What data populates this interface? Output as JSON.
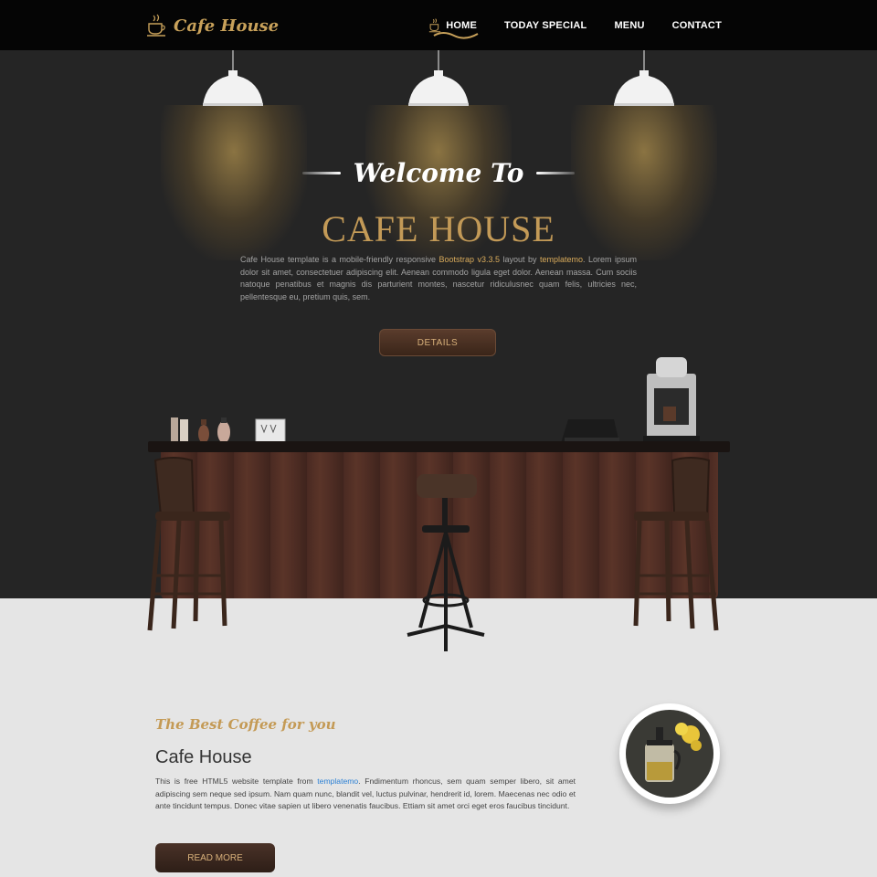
{
  "brand": {
    "name": "Cafe House",
    "icon": "coffee-cup-icon"
  },
  "nav": {
    "items": [
      {
        "label": "HOME",
        "icon": "coffee-cup-icon",
        "active": true
      },
      {
        "label": "TODAY SPECIAL"
      },
      {
        "label": "MENU"
      },
      {
        "label": "CONTACT"
      }
    ]
  },
  "hero": {
    "welcome": "Welcome To",
    "title": "CAFE HOUSE",
    "desc_pre": "Cafe House template is a mobile-friendly responsive ",
    "desc_bootstrap": "Bootstrap v3.3.5",
    "desc_mid": " layout by ",
    "desc_templatemo": "templatemo",
    "desc_post": ". Lorem ipsum dolor sit amet, consectetuer adipiscing elit. Aenean commodo ligula eget dolor. Aenean massa. Cum sociis natoque penatibus et magnis dis parturient montes, nascetur ridiculusnec quam felis, ultricies nec, pellentesque eu, pretium quis, sem.",
    "button": "DETAILS"
  },
  "about": {
    "tagline": "The Best Coffee for you",
    "title": "Cafe House",
    "desc_pre": "This is free HTML5 website template from ",
    "desc_link": "templatemo",
    "desc_post": ". Fndimentum rhoncus, sem quam semper libero, sit amet adipiscing sem neque sed ipsum. Nam quam nunc, blandit vel, luctus pulvinar, hendrerit id, lorem. Maecenas nec odio et ante tincidunt tempus. Donec vitae sapien ut libero venenatis faucibus. Ettiam sit amet orci eget eros faucibus tincidunt.",
    "button": "READ MORE"
  },
  "colors": {
    "gold": "#c39a57",
    "dark": "#252525",
    "navbar": "#050505",
    "floor": "#e5e5e5"
  }
}
